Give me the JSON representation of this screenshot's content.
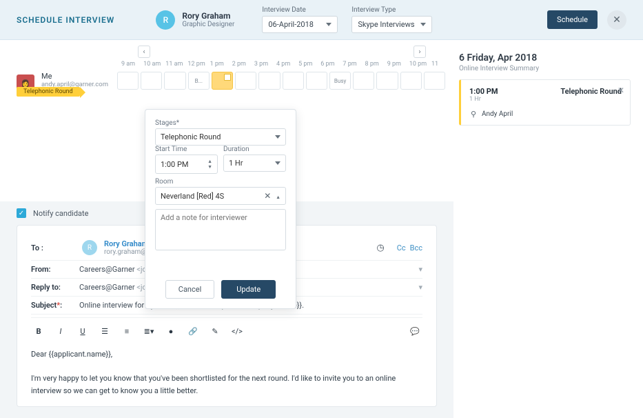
{
  "header": {
    "title": "SCHEDULE INTERVIEW",
    "candidate": {
      "initial": "R",
      "name": "Rory Graham",
      "role": "Graphic Designer"
    },
    "date_label": "Interview Date",
    "date_value": "06-April-2018",
    "type_label": "Interview Type",
    "type_value": "Skype Interviews",
    "schedule_btn": "Schedule"
  },
  "calendar": {
    "hours": [
      "9 am",
      "10 am",
      "11 am",
      "12 pm",
      "1 pm",
      "2 pm",
      "3 pm",
      "4 pm",
      "5 pm",
      "6 pm",
      "7 pm",
      "8 pm",
      "9 pm",
      "10 pm",
      "11"
    ],
    "badge": "Telephonic Round",
    "me": {
      "name": "Me",
      "email": "andy.april@garner.com"
    },
    "busy_label": "Busy",
    "b_label": "B..."
  },
  "popover": {
    "stages_label": "Stages*",
    "stages_value": "Telephonic Round",
    "start_label": "Start Time",
    "start_value": "1:00 PM",
    "dur_label": "Duration",
    "dur_value": "1 Hr",
    "room_label": "Room",
    "room_value": "Neverland [Red] 4S",
    "note_placeholder": "Add a note for interviewer",
    "cancel": "Cancel",
    "update": "Update"
  },
  "notify": {
    "label": "Notify candidate"
  },
  "email": {
    "to_label": "To  :",
    "to_name": "Rory Graham",
    "to_email": "rory.graham@gmail.com",
    "cc": "Cc",
    "bcc": "Bcc",
    "from_label": "From:",
    "from_name": "Careers@Garner",
    "from_addr": "<jobs@garner.com>",
    "reply_label": "Reply to:",
    "reply_name": "Careers@Garner",
    "reply_addr": "<jobs@garner.com>",
    "subject_label": "Subject",
    "subject_value": "Online interview for {{job.title}} at {{career_portal.company_name}}.",
    "body_greet": "Dear {{applicant.name}},",
    "body_text": "I'm very happy to let you know that you've been shortlisted for the next round. I'd like to invite you to an online interview so we can get to know you a little better."
  },
  "summary": {
    "date": "6 Friday, Apr 2018",
    "sub": "Online Interview Summary",
    "time": "1:00 PM",
    "stage": "Telephonic Round",
    "dur": "1 Hr",
    "person": "Andy April"
  }
}
